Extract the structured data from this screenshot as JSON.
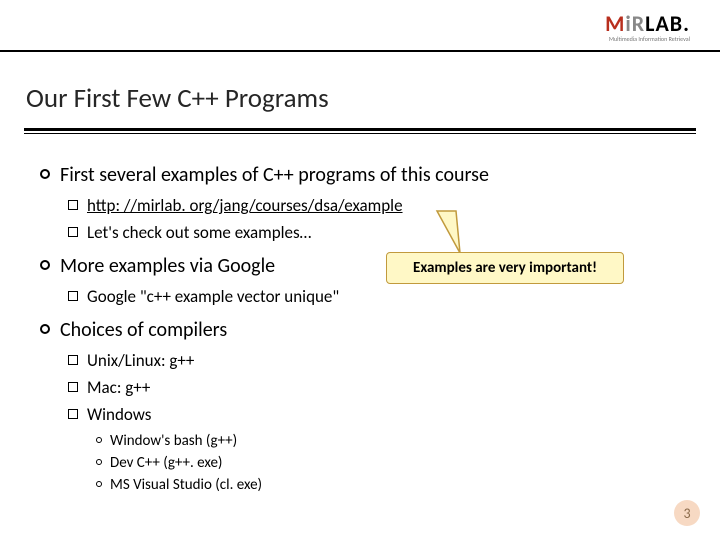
{
  "logo": {
    "brand_letters": {
      "m": "M",
      "i": "i",
      "r": "R"
    },
    "lab": "LAB.",
    "subtitle": "Multimedia Information Retrieval"
  },
  "title": "Our First Few C++ Programs",
  "bullets": {
    "b1": {
      "text": "First several examples of C++ programs of this course",
      "sub": {
        "s1_link": "http: //mirlab. org/jang/courses/dsa/example",
        "s2": "Let's check out some examples…"
      }
    },
    "b2": {
      "text": "More examples via Google",
      "sub": {
        "s1": "Google \"c++ example vector unique\""
      }
    },
    "b3": {
      "text": "Choices of compilers",
      "sub": {
        "s1": "Unix/Linux: g++",
        "s2": "Mac: g++",
        "s3": "Windows",
        "s3sub": {
          "x1": "Window's bash (g++)",
          "x2": "Dev C++ (g++. exe)",
          "x3": "MS Visual Studio (cl. exe)"
        }
      }
    }
  },
  "callout": "Examples are very important!",
  "page_number": "3"
}
